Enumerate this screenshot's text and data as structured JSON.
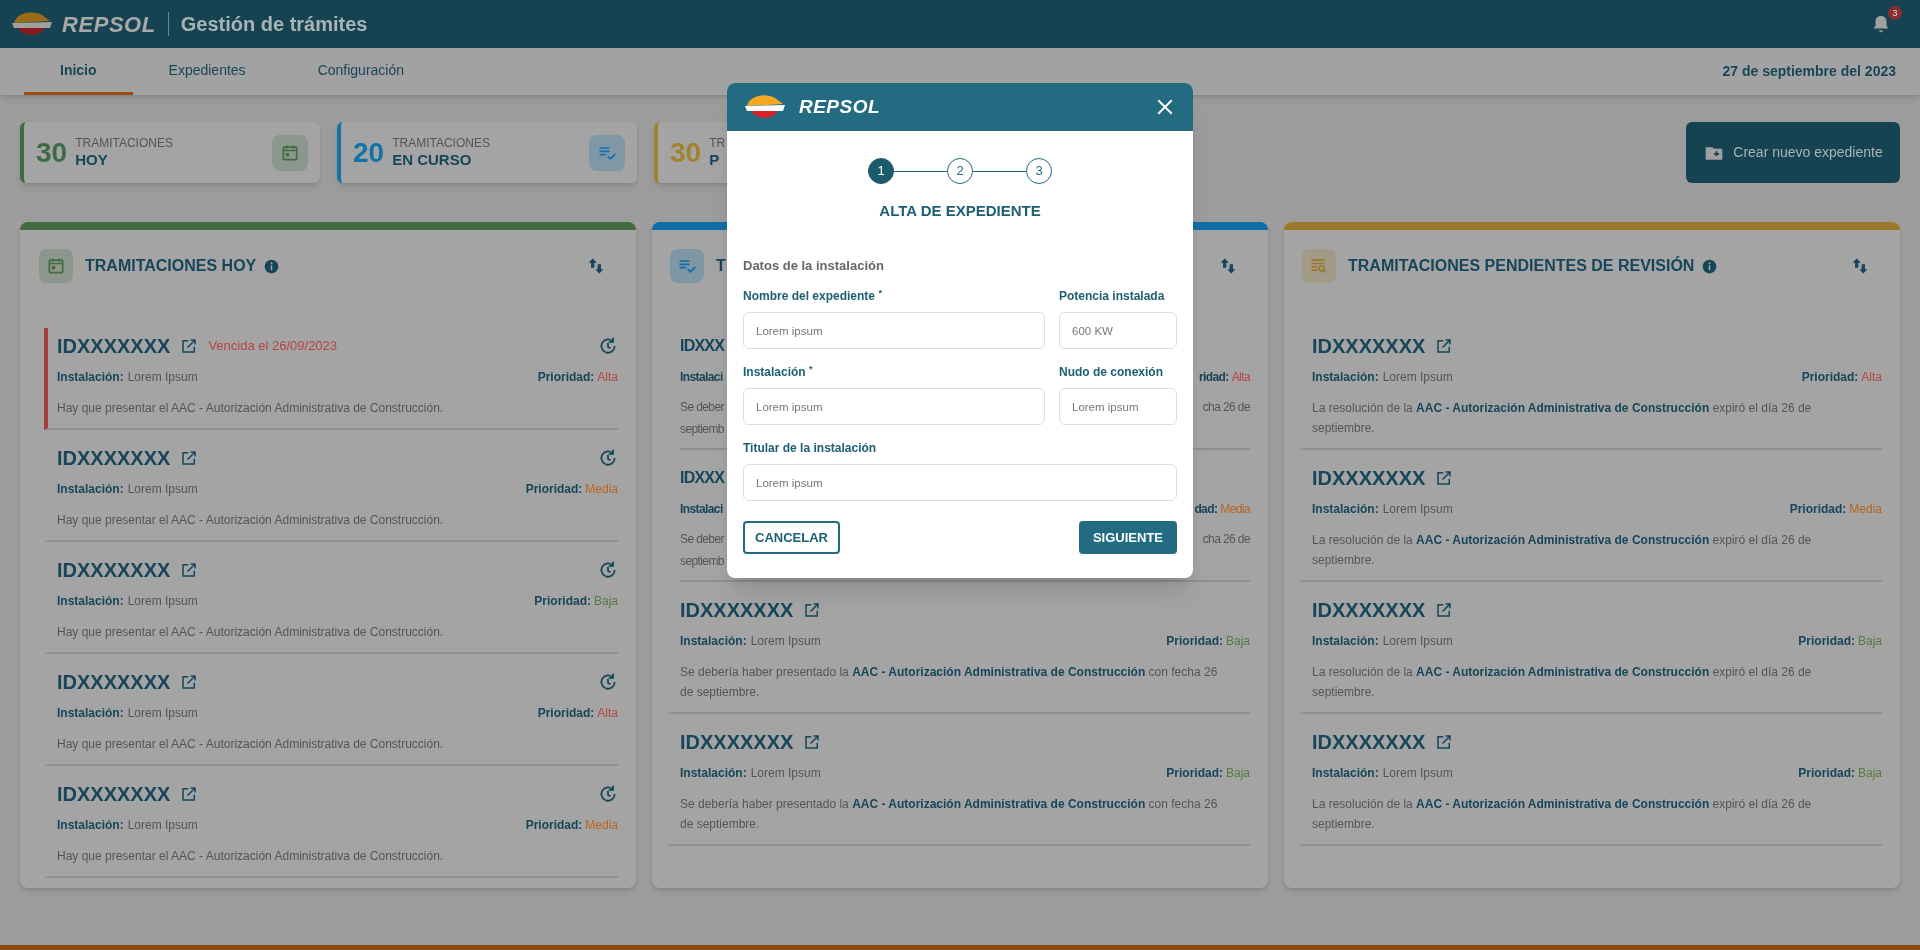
{
  "header": {
    "brand": "REPSOL",
    "title": "Gestión de trámites",
    "notification_count": "3"
  },
  "tabs": [
    {
      "label": "Inicio",
      "selected": true
    },
    {
      "label": "Expedientes",
      "selected": false
    },
    {
      "label": "Configuración",
      "selected": false
    }
  ],
  "date": "27 de septiembre del 2023",
  "stats": [
    {
      "value": "30",
      "label_top": "TRAMITACIONES",
      "label_bottom": "HOY",
      "color": "#3f6b44",
      "kind": "calendar"
    },
    {
      "value": "20",
      "label_top": "TRAMITACIONES",
      "label_bottom": "EN CURSO",
      "color": "#1273a8",
      "kind": "checklist"
    },
    {
      "value": "30",
      "label_top": "TR",
      "label_bottom": "P",
      "color": "#a3822f",
      "kind": "none"
    }
  ],
  "create_button": "Crear nuevo expediente",
  "columns": [
    {
      "kind": "calendar",
      "title": "TRAMITACIONES HOY",
      "info_icon": true,
      "color": "#426b42",
      "items": [
        {
          "kind": "full",
          "id": "IDXXXXXXX",
          "overdue": true,
          "note": "Vencida el 26/09/2023",
          "installation_label": "Instalación:",
          "installation": "Lorem Ipsum",
          "priority_label": "Prioridad:",
          "priority": {
            "text": "Alta",
            "color": "#b84444"
          },
          "description": "Hay que presentar el AAC - Autorización Administrativa de Construcción."
        },
        {
          "kind": "full",
          "id": "IDXXXXXXX",
          "overdue": false,
          "installation_label": "Instalación:",
          "installation": "Lorem Ipsum",
          "priority_label": "Prioridad:",
          "priority": {
            "text": "Media",
            "color": "#b8651f"
          },
          "description": "Hay que presentar el AAC - Autorización Administrativa de Construcción."
        },
        {
          "kind": "full",
          "id": "IDXXXXXXX",
          "overdue": false,
          "installation_label": "Instalación:",
          "installation": "Lorem Ipsum",
          "priority_label": "Prioridad:",
          "priority": {
            "text": "Baja",
            "color": "#557a40"
          },
          "description": "Hay que presentar el AAC - Autorización Administrativa de Construcción."
        },
        {
          "kind": "full",
          "id": "IDXXXXXXX",
          "overdue": false,
          "installation_label": "Instalación:",
          "installation": "Lorem Ipsum",
          "priority_label": "Prioridad:",
          "priority": {
            "text": "Alta",
            "color": "#b84444"
          },
          "description": "Hay que presentar el AAC - Autorización Administrativa de Construcción."
        },
        {
          "kind": "full",
          "id": "IDXXXXXXX",
          "overdue": false,
          "installation_label": "Instalación:",
          "installation": "Lorem Ipsum",
          "priority_label": "Prioridad:",
          "priority": {
            "text": "Media",
            "color": "#b8651f"
          },
          "description": "Hay que presentar el AAC - Autorización Administrativa de Construcción."
        }
      ]
    },
    {
      "kind": "checklist",
      "title": "T",
      "info_icon": false,
      "color": "#0e6ea6",
      "items": [
        {
          "kind": "covered",
          "id": "IDXXX",
          "installation_label": "Instalaci",
          "priority_label": "ridad:",
          "priority": {
            "text": "Alta",
            "color": "#b84444"
          },
          "description_start": "Se deber",
          "description_end": "cha 26 de",
          "description_line2": "septiemb"
        },
        {
          "kind": "covered",
          "id": "IDXXX",
          "installation_label": "Instalaci",
          "priority_label": "dad:",
          "priority": {
            "text": "Media",
            "color": "#b8651f"
          },
          "description_start": "Se deber",
          "description_end": "cha 26 de",
          "description_line2": "septiemb"
        },
        {
          "kind": "full",
          "id": "IDXXXXXXX",
          "overdue": false,
          "installation_label": "Instalación:",
          "installation": "Lorem Ipsum",
          "priority_label": "Prioridad:",
          "priority": {
            "text": "Baja",
            "color": "#557a40"
          },
          "description": "Se debería haber presentado la **AAC - Autorización Administrativa de Construcción** con fecha 26 de septiembre."
        },
        {
          "kind": "full",
          "id": "IDXXXXXXX",
          "overdue": false,
          "installation_label": "Instalación:",
          "installation": "Lorem Ipsum",
          "priority_label": "Prioridad:",
          "priority": {
            "text": "Baja",
            "color": "#557a40"
          },
          "description": "Se debería haber presentado la **AAC - Autorización Administrativa de Construcción** con fecha 26 de septiembre."
        }
      ]
    },
    {
      "kind": "review",
      "title": "TRAMITACIONES PENDIENTES DE REVISIÓN",
      "info_icon": true,
      "color": "#9a7a2a",
      "items": [
        {
          "kind": "full",
          "id": "IDXXXXXXX",
          "overdue": false,
          "installation_label": "Instalación:",
          "installation": "Lorem Ipsum",
          "priority_label": "Prioridad:",
          "priority": {
            "text": "Alta",
            "color": "#b84444"
          },
          "description": "La resolución de la **AAC - Autorización Administrativa de Construcción** expiró el día 26 de septiembre."
        },
        {
          "kind": "full",
          "id": "IDXXXXXXX",
          "overdue": false,
          "installation_label": "Instalación:",
          "installation": "Lorem Ipsum",
          "priority_label": "Prioridad:",
          "priority": {
            "text": "Media",
            "color": "#b8651f"
          },
          "description": "La resolución de la **AAC - Autorización Administrativa de Construcción** expiró el día 26 de septiembre."
        },
        {
          "kind": "full",
          "id": "IDXXXXXXX",
          "overdue": false,
          "installation_label": "Instalación:",
          "installation": "Lorem Ipsum",
          "priority_label": "Prioridad:",
          "priority": {
            "text": "Baja",
            "color": "#557a40"
          },
          "description": "La resolución de la **AAC - Autorización Administrativa de Construcción** expiró el día 26 de septiembre."
        },
        {
          "kind": "full",
          "id": "IDXXXXXXX",
          "overdue": false,
          "installation_label": "Instalación:",
          "installation": "Lorem Ipsum",
          "priority_label": "Prioridad:",
          "priority": {
            "text": "Baja",
            "color": "#557a40"
          },
          "description": "La resolución de la **AAC - Autorización Administrativa de Construcción** expiró el día 26 de septiembre."
        }
      ]
    }
  ],
  "modal": {
    "brand": "REPSOL",
    "steps": [
      {
        "label": "1",
        "selected": true
      },
      {
        "label": "2",
        "selected": false
      },
      {
        "label": "3",
        "selected": false
      }
    ],
    "title": "ALTA DE EXPEDIENTE",
    "section": "Datos de la instalación",
    "fields": [
      {
        "kind": "wide",
        "label": "Nombre del expediente $^{*}$",
        "placeholder": "Lorem ipsum"
      },
      {
        "kind": "narrow",
        "label": "Potencia instalada",
        "placeholder": "600 KW"
      },
      {
        "kind": "wide",
        "label": "Instalación $^{*}$",
        "placeholder": "Lorem ipsum"
      },
      {
        "kind": "narrow",
        "label": "Nudo de conexión",
        "placeholder": "Lorem ipsum"
      },
      {
        "kind": "full",
        "label": "Titular de la instalación",
        "placeholder": "Lorem ipsum"
      }
    ],
    "cancel_button": "CANCELAR",
    "next_button": "SIGUIENTE"
  }
}
